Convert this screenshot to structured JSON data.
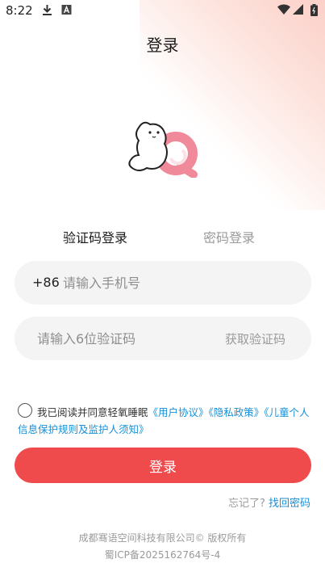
{
  "status_bar": {
    "time": "8:22",
    "left_icons": [
      "download-icon",
      "a-notification-icon"
    ],
    "right_icons": [
      "wifi-icon",
      "signal-icon",
      "battery-icon"
    ]
  },
  "page": {
    "title": "登录"
  },
  "tabs": [
    {
      "label": "验证码登录",
      "active": true
    },
    {
      "label": "密码登录",
      "active": false
    }
  ],
  "phone_field": {
    "prefix": "+86",
    "placeholder": "请输入手机号",
    "value": ""
  },
  "code_field": {
    "placeholder": "请输入6位验证码",
    "value": "",
    "get_code_label": "获取验证码"
  },
  "agreement": {
    "checked": false,
    "text": "我已阅读并同意轻氧睡眠",
    "links": [
      "《用户协议》",
      "《隐私政策》",
      "《儿童个人信息保护规则及监护人须知》"
    ]
  },
  "login_button": {
    "label": "登录"
  },
  "forgot": {
    "question": "忘记了?",
    "link": "找回密码"
  },
  "footer": {
    "line1": "成都骞语空间科技有限公司© 版权所有",
    "line2": "蜀ICP备2025162764号-4"
  },
  "colors": {
    "accent": "#ef4b4c",
    "link": "#1a8fd6",
    "field_bg": "#f4f4f5",
    "muted": "#9a9a9a"
  }
}
